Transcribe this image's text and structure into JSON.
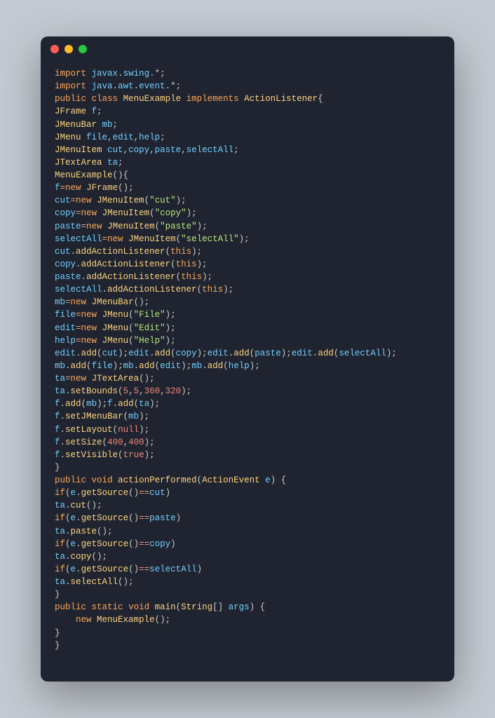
{
  "window": {
    "dots": [
      "red",
      "yellow",
      "green"
    ]
  },
  "code": {
    "lines": [
      [
        [
          "k",
          "import"
        ],
        [
          "p",
          " "
        ],
        [
          "v",
          "javax"
        ],
        [
          "p",
          "."
        ],
        [
          "v",
          "swing"
        ],
        [
          "p",
          ".*;"
        ]
      ],
      [
        [
          "k",
          "import"
        ],
        [
          "p",
          " "
        ],
        [
          "v",
          "java"
        ],
        [
          "p",
          "."
        ],
        [
          "v",
          "awt"
        ],
        [
          "p",
          "."
        ],
        [
          "v",
          "event"
        ],
        [
          "p",
          ".*;"
        ]
      ],
      [
        [
          "k",
          "public"
        ],
        [
          "p",
          " "
        ],
        [
          "k",
          "class"
        ],
        [
          "p",
          " "
        ],
        [
          "cl",
          "MenuExample"
        ],
        [
          "p",
          " "
        ],
        [
          "k",
          "implements"
        ],
        [
          "p",
          " "
        ],
        [
          "cl",
          "ActionListener"
        ],
        [
          "p",
          "{"
        ]
      ],
      [
        [
          "cl",
          "JFrame"
        ],
        [
          "p",
          " "
        ],
        [
          "v",
          "f"
        ],
        [
          "p",
          ";"
        ]
      ],
      [
        [
          "cl",
          "JMenuBar"
        ],
        [
          "p",
          " "
        ],
        [
          "v",
          "mb"
        ],
        [
          "p",
          ";"
        ]
      ],
      [
        [
          "cl",
          "JMenu"
        ],
        [
          "p",
          " "
        ],
        [
          "v",
          "file"
        ],
        [
          "p",
          ","
        ],
        [
          "v",
          "edit"
        ],
        [
          "p",
          ","
        ],
        [
          "v",
          "help"
        ],
        [
          "p",
          ";"
        ]
      ],
      [
        [
          "cl",
          "JMenuItem"
        ],
        [
          "p",
          " "
        ],
        [
          "v",
          "cut"
        ],
        [
          "p",
          ","
        ],
        [
          "v",
          "copy"
        ],
        [
          "p",
          ","
        ],
        [
          "v",
          "paste"
        ],
        [
          "p",
          ","
        ],
        [
          "v",
          "selectAll"
        ],
        [
          "p",
          ";"
        ]
      ],
      [
        [
          "cl",
          "JTextArea"
        ],
        [
          "p",
          " "
        ],
        [
          "v",
          "ta"
        ],
        [
          "p",
          ";"
        ]
      ],
      [
        [
          "cl",
          "MenuExample"
        ],
        [
          "p",
          "(){"
        ]
      ],
      [
        [
          "v",
          "f"
        ],
        [
          "op",
          "="
        ],
        [
          "k",
          "new"
        ],
        [
          "p",
          " "
        ],
        [
          "cl",
          "JFrame"
        ],
        [
          "p",
          "();"
        ]
      ],
      [
        [
          "v",
          "cut"
        ],
        [
          "op",
          "="
        ],
        [
          "k",
          "new"
        ],
        [
          "p",
          " "
        ],
        [
          "cl",
          "JMenuItem"
        ],
        [
          "p",
          "("
        ],
        [
          "s",
          "\"cut\""
        ],
        [
          "p",
          ");"
        ]
      ],
      [
        [
          "v",
          "copy"
        ],
        [
          "op",
          "="
        ],
        [
          "k",
          "new"
        ],
        [
          "p",
          " "
        ],
        [
          "cl",
          "JMenuItem"
        ],
        [
          "p",
          "("
        ],
        [
          "s",
          "\"copy\""
        ],
        [
          "p",
          ");"
        ]
      ],
      [
        [
          "v",
          "paste"
        ],
        [
          "op",
          "="
        ],
        [
          "k",
          "new"
        ],
        [
          "p",
          " "
        ],
        [
          "cl",
          "JMenuItem"
        ],
        [
          "p",
          "("
        ],
        [
          "s",
          "\"paste\""
        ],
        [
          "p",
          ");"
        ]
      ],
      [
        [
          "v",
          "selectAll"
        ],
        [
          "op",
          "="
        ],
        [
          "k",
          "new"
        ],
        [
          "p",
          " "
        ],
        [
          "cl",
          "JMenuItem"
        ],
        [
          "p",
          "("
        ],
        [
          "s",
          "\"selectAll\""
        ],
        [
          "p",
          ");"
        ]
      ],
      [
        [
          "v",
          "cut"
        ],
        [
          "p",
          "."
        ],
        [
          "fn",
          "addActionListener"
        ],
        [
          "p",
          "("
        ],
        [
          "k",
          "this"
        ],
        [
          "p",
          ");"
        ]
      ],
      [
        [
          "v",
          "copy"
        ],
        [
          "p",
          "."
        ],
        [
          "fn",
          "addActionListener"
        ],
        [
          "p",
          "("
        ],
        [
          "k",
          "this"
        ],
        [
          "p",
          ");"
        ]
      ],
      [
        [
          "v",
          "paste"
        ],
        [
          "p",
          "."
        ],
        [
          "fn",
          "addActionListener"
        ],
        [
          "p",
          "("
        ],
        [
          "k",
          "this"
        ],
        [
          "p",
          ");"
        ]
      ],
      [
        [
          "v",
          "selectAll"
        ],
        [
          "p",
          "."
        ],
        [
          "fn",
          "addActionListener"
        ],
        [
          "p",
          "("
        ],
        [
          "k",
          "this"
        ],
        [
          "p",
          ");"
        ]
      ],
      [
        [
          "v",
          "mb"
        ],
        [
          "op",
          "="
        ],
        [
          "k",
          "new"
        ],
        [
          "p",
          " "
        ],
        [
          "cl",
          "JMenuBar"
        ],
        [
          "p",
          "();"
        ]
      ],
      [
        [
          "v",
          "file"
        ],
        [
          "op",
          "="
        ],
        [
          "k",
          "new"
        ],
        [
          "p",
          " "
        ],
        [
          "cl",
          "JMenu"
        ],
        [
          "p",
          "("
        ],
        [
          "s",
          "\"File\""
        ],
        [
          "p",
          ");"
        ]
      ],
      [
        [
          "v",
          "edit"
        ],
        [
          "op",
          "="
        ],
        [
          "k",
          "new"
        ],
        [
          "p",
          " "
        ],
        [
          "cl",
          "JMenu"
        ],
        [
          "p",
          "("
        ],
        [
          "s",
          "\"Edit\""
        ],
        [
          "p",
          ");"
        ]
      ],
      [
        [
          "v",
          "help"
        ],
        [
          "op",
          "="
        ],
        [
          "k",
          "new"
        ],
        [
          "p",
          " "
        ],
        [
          "cl",
          "JMenu"
        ],
        [
          "p",
          "("
        ],
        [
          "s",
          "\"Help\""
        ],
        [
          "p",
          ");"
        ]
      ],
      [
        [
          "v",
          "edit"
        ],
        [
          "p",
          "."
        ],
        [
          "fn",
          "add"
        ],
        [
          "p",
          "("
        ],
        [
          "v",
          "cut"
        ],
        [
          "p",
          ");"
        ],
        [
          "v",
          "edit"
        ],
        [
          "p",
          "."
        ],
        [
          "fn",
          "add"
        ],
        [
          "p",
          "("
        ],
        [
          "v",
          "copy"
        ],
        [
          "p",
          ");"
        ],
        [
          "v",
          "edit"
        ],
        [
          "p",
          "."
        ],
        [
          "fn",
          "add"
        ],
        [
          "p",
          "("
        ],
        [
          "v",
          "paste"
        ],
        [
          "p",
          ");"
        ],
        [
          "v",
          "edit"
        ],
        [
          "p",
          "."
        ],
        [
          "fn",
          "add"
        ],
        [
          "p",
          "("
        ],
        [
          "v",
          "selectAll"
        ],
        [
          "p",
          ");"
        ]
      ],
      [
        [
          "v",
          "mb"
        ],
        [
          "p",
          "."
        ],
        [
          "fn",
          "add"
        ],
        [
          "p",
          "("
        ],
        [
          "v",
          "file"
        ],
        [
          "p",
          ");"
        ],
        [
          "v",
          "mb"
        ],
        [
          "p",
          "."
        ],
        [
          "fn",
          "add"
        ],
        [
          "p",
          "("
        ],
        [
          "v",
          "edit"
        ],
        [
          "p",
          ");"
        ],
        [
          "v",
          "mb"
        ],
        [
          "p",
          "."
        ],
        [
          "fn",
          "add"
        ],
        [
          "p",
          "("
        ],
        [
          "v",
          "help"
        ],
        [
          "p",
          ");"
        ]
      ],
      [
        [
          "v",
          "ta"
        ],
        [
          "op",
          "="
        ],
        [
          "k",
          "new"
        ],
        [
          "p",
          " "
        ],
        [
          "cl",
          "JTextArea"
        ],
        [
          "p",
          "();"
        ]
      ],
      [
        [
          "v",
          "ta"
        ],
        [
          "p",
          "."
        ],
        [
          "fn",
          "setBounds"
        ],
        [
          "p",
          "("
        ],
        [
          "n",
          "5"
        ],
        [
          "p",
          ","
        ],
        [
          "n",
          "5"
        ],
        [
          "p",
          ","
        ],
        [
          "n",
          "360"
        ],
        [
          "p",
          ","
        ],
        [
          "n",
          "320"
        ],
        [
          "p",
          ");"
        ]
      ],
      [
        [
          "v",
          "f"
        ],
        [
          "p",
          "."
        ],
        [
          "fn",
          "add"
        ],
        [
          "p",
          "("
        ],
        [
          "v",
          "mb"
        ],
        [
          "p",
          ");"
        ],
        [
          "v",
          "f"
        ],
        [
          "p",
          "."
        ],
        [
          "fn",
          "add"
        ],
        [
          "p",
          "("
        ],
        [
          "v",
          "ta"
        ],
        [
          "p",
          ");"
        ]
      ],
      [
        [
          "v",
          "f"
        ],
        [
          "p",
          "."
        ],
        [
          "fn",
          "setJMenuBar"
        ],
        [
          "p",
          "("
        ],
        [
          "v",
          "mb"
        ],
        [
          "p",
          ");"
        ]
      ],
      [
        [
          "v",
          "f"
        ],
        [
          "p",
          "."
        ],
        [
          "fn",
          "setLayout"
        ],
        [
          "p",
          "("
        ],
        [
          "b",
          "null"
        ],
        [
          "p",
          ");"
        ]
      ],
      [
        [
          "v",
          "f"
        ],
        [
          "p",
          "."
        ],
        [
          "fn",
          "setSize"
        ],
        [
          "p",
          "("
        ],
        [
          "n",
          "400"
        ],
        [
          "p",
          ","
        ],
        [
          "n",
          "400"
        ],
        [
          "p",
          ");"
        ]
      ],
      [
        [
          "v",
          "f"
        ],
        [
          "p",
          "."
        ],
        [
          "fn",
          "setVisible"
        ],
        [
          "p",
          "("
        ],
        [
          "b",
          "true"
        ],
        [
          "p",
          ");"
        ]
      ],
      [
        [
          "p",
          "}"
        ]
      ],
      [
        [
          "k",
          "public"
        ],
        [
          "p",
          " "
        ],
        [
          "k",
          "void"
        ],
        [
          "p",
          " "
        ],
        [
          "fn",
          "actionPerformed"
        ],
        [
          "p",
          "("
        ],
        [
          "cl",
          "ActionEvent"
        ],
        [
          "p",
          " "
        ],
        [
          "v",
          "e"
        ],
        [
          "p",
          ") {"
        ]
      ],
      [
        [
          "k",
          "if"
        ],
        [
          "p",
          "("
        ],
        [
          "v",
          "e"
        ],
        [
          "p",
          "."
        ],
        [
          "fn",
          "getSource"
        ],
        [
          "p",
          "()"
        ],
        [
          "op",
          "=="
        ],
        [
          "v",
          "cut"
        ],
        [
          "p",
          ")"
        ]
      ],
      [
        [
          "v",
          "ta"
        ],
        [
          "p",
          "."
        ],
        [
          "fn",
          "cut"
        ],
        [
          "p",
          "();"
        ]
      ],
      [
        [
          "k",
          "if"
        ],
        [
          "p",
          "("
        ],
        [
          "v",
          "e"
        ],
        [
          "p",
          "."
        ],
        [
          "fn",
          "getSource"
        ],
        [
          "p",
          "()"
        ],
        [
          "op",
          "=="
        ],
        [
          "v",
          "paste"
        ],
        [
          "p",
          ")"
        ]
      ],
      [
        [
          "v",
          "ta"
        ],
        [
          "p",
          "."
        ],
        [
          "fn",
          "paste"
        ],
        [
          "p",
          "();"
        ]
      ],
      [
        [
          "k",
          "if"
        ],
        [
          "p",
          "("
        ],
        [
          "v",
          "e"
        ],
        [
          "p",
          "."
        ],
        [
          "fn",
          "getSource"
        ],
        [
          "p",
          "()"
        ],
        [
          "op",
          "=="
        ],
        [
          "v",
          "copy"
        ],
        [
          "p",
          ")"
        ]
      ],
      [
        [
          "v",
          "ta"
        ],
        [
          "p",
          "."
        ],
        [
          "fn",
          "copy"
        ],
        [
          "p",
          "();"
        ]
      ],
      [
        [
          "k",
          "if"
        ],
        [
          "p",
          "("
        ],
        [
          "v",
          "e"
        ],
        [
          "p",
          "."
        ],
        [
          "fn",
          "getSource"
        ],
        [
          "p",
          "()"
        ],
        [
          "op",
          "=="
        ],
        [
          "v",
          "selectAll"
        ],
        [
          "p",
          ")"
        ]
      ],
      [
        [
          "v",
          "ta"
        ],
        [
          "p",
          "."
        ],
        [
          "fn",
          "selectAll"
        ],
        [
          "p",
          "();"
        ]
      ],
      [
        [
          "p",
          "}"
        ]
      ],
      [
        [
          "k",
          "public"
        ],
        [
          "p",
          " "
        ],
        [
          "k",
          "static"
        ],
        [
          "p",
          " "
        ],
        [
          "k",
          "void"
        ],
        [
          "p",
          " "
        ],
        [
          "fn",
          "main"
        ],
        [
          "p",
          "("
        ],
        [
          "cl",
          "String"
        ],
        [
          "p",
          "[] "
        ],
        [
          "v",
          "args"
        ],
        [
          "p",
          ") {"
        ]
      ],
      [
        [
          "p",
          "    "
        ],
        [
          "k",
          "new"
        ],
        [
          "p",
          " "
        ],
        [
          "cl",
          "MenuExample"
        ],
        [
          "p",
          "();"
        ]
      ],
      [
        [
          "p",
          "}"
        ]
      ],
      [
        [
          "p",
          "}"
        ]
      ]
    ]
  }
}
